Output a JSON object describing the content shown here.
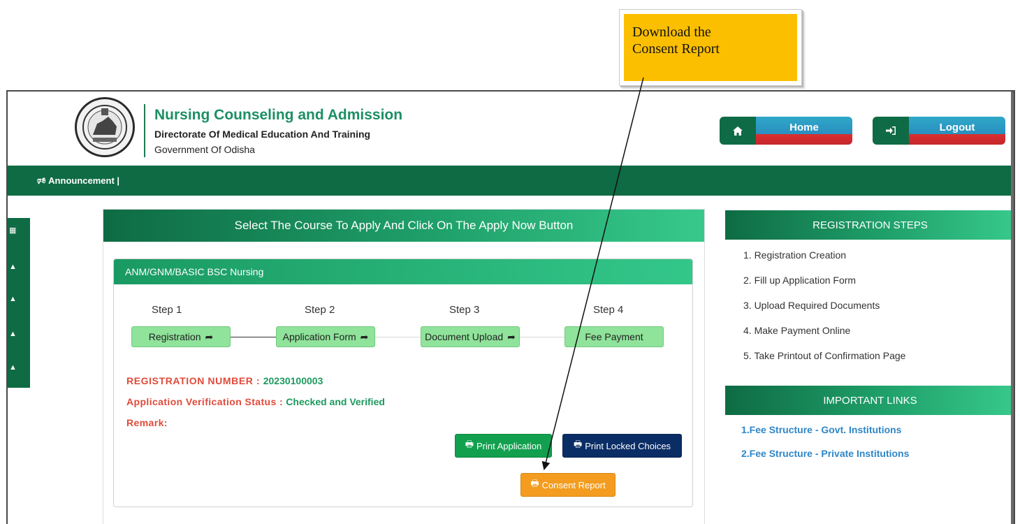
{
  "callout": {
    "line1": "Download the",
    "line2": "Consent Report"
  },
  "header": {
    "title": "Nursing Counseling and Admission",
    "subtitle": "Directorate Of Medical Education And Training",
    "subtitle2": "Government Of Odisha",
    "home_label": "Home",
    "logout_label": "Logout"
  },
  "nav": {
    "announcement": "Announcement  |"
  },
  "main": {
    "panel_title": "Select The Course To Apply And Click On The Apply Now Button",
    "card_title": "ANM/GNM/BASIC BSC Nursing",
    "steps": [
      {
        "label": "Step 1",
        "button": "Registration"
      },
      {
        "label": "Step 2",
        "button": "Application Form"
      },
      {
        "label": "Step 3",
        "button": "Document Upload"
      },
      {
        "label": "Step 4",
        "button": "Fee Payment"
      }
    ],
    "registration_label": "REGISTRATION NUMBER : ",
    "registration_number": "20230100003",
    "verification_label": "Application Verification Status : ",
    "verification_status": "Checked and Verified",
    "remark_label": "Remark:",
    "print_application": "Print Application",
    "print_locked": "Print Locked Choices",
    "consent_report": "Consent Report"
  },
  "right": {
    "steps_title": "REGISTRATION STEPS",
    "steps": [
      "1. Registration Creation",
      "2. Fill up Application Form",
      "3. Upload Required Documents",
      "4. Make Payment Online",
      "5. Take Printout of Confirmation Page"
    ],
    "links_title": "IMPORTANT LINKS",
    "links": [
      "1.Fee Structure - Govt. Institutions",
      "2.Fee Structure - Private Institutions"
    ]
  },
  "colors": {
    "brand_green": "#0e6b43",
    "accent_green": "#1c8f64",
    "callout": "#fcbf00",
    "consent_orange": "#f39c1f",
    "locked_navy": "#0b2d66"
  },
  "icons": [
    "home-icon",
    "sign-in-icon",
    "bullhorn-icon",
    "print-icon",
    "share-arrow-icon",
    "bell-icon",
    "dashboard-icon"
  ]
}
